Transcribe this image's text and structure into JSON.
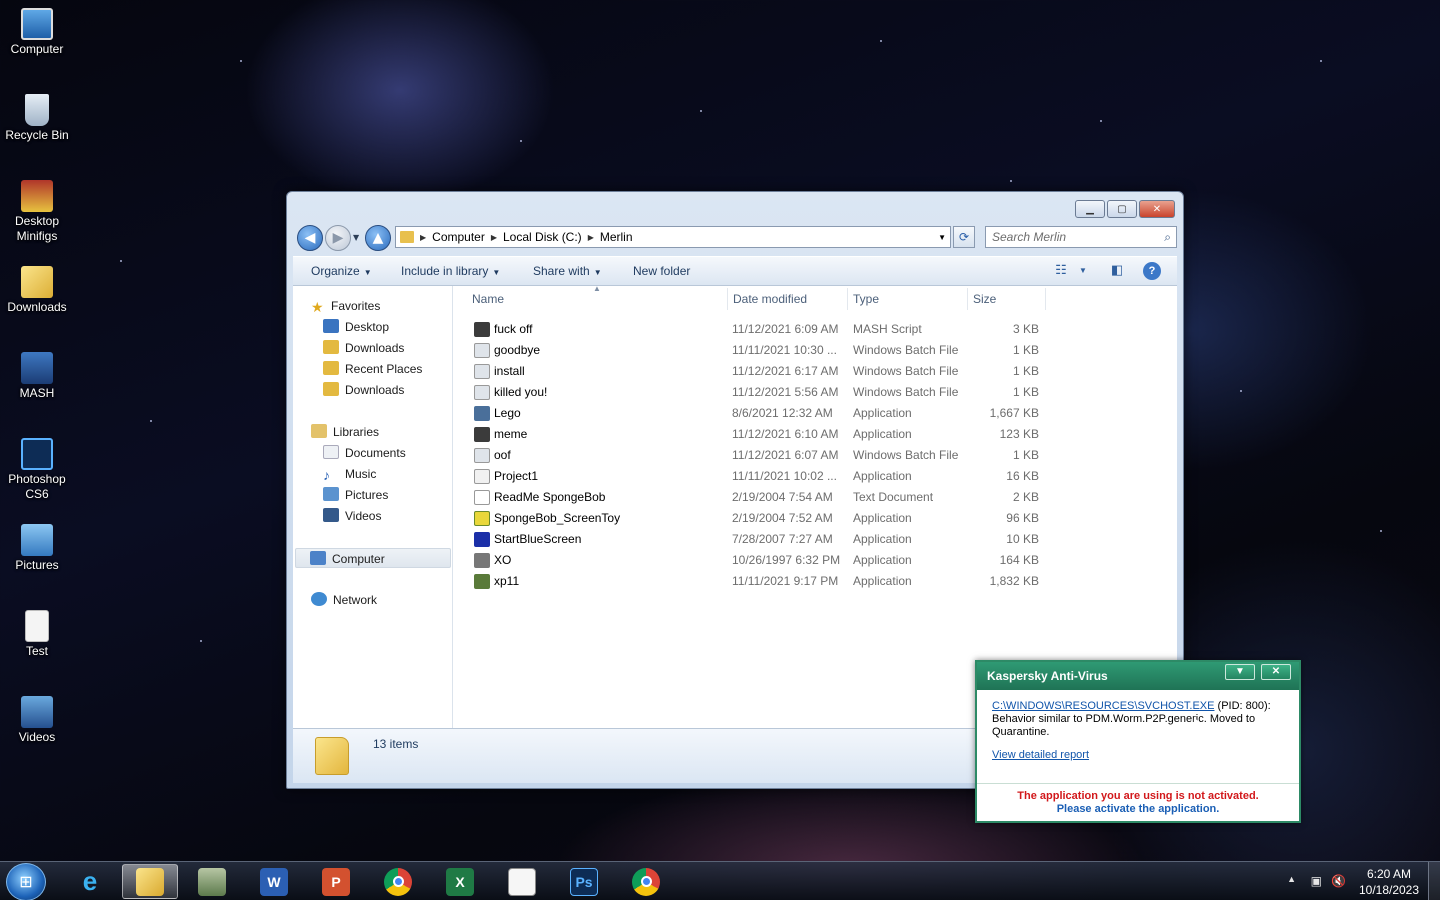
{
  "desktop": {
    "icons": [
      {
        "label": "Computer"
      },
      {
        "label": "Recycle Bin"
      },
      {
        "label": "Desktop Minifigs"
      },
      {
        "label": "Downloads"
      },
      {
        "label": "MASH"
      },
      {
        "label": "Photoshop CS6"
      },
      {
        "label": "Pictures"
      },
      {
        "label": "Test"
      },
      {
        "label": "Videos"
      }
    ]
  },
  "explorer": {
    "address": [
      "Computer",
      "Local Disk (C:)",
      "Merlin"
    ],
    "search_placeholder": "Search Merlin",
    "toolbar": {
      "organize": "Organize",
      "include_in_library": "Include in library",
      "share_with": "Share with",
      "new_folder": "New folder"
    },
    "nav": {
      "favorites": "Favorites",
      "favorites_items": [
        "Desktop",
        "Downloads",
        "Recent Places",
        "Downloads"
      ],
      "libraries": "Libraries",
      "libraries_items": [
        "Documents",
        "Music",
        "Pictures",
        "Videos"
      ],
      "computer": "Computer",
      "network": "Network"
    },
    "columns": {
      "name": "Name",
      "date": "Date modified",
      "type": "Type",
      "size": "Size"
    },
    "files": [
      {
        "name": "fuck off",
        "date": "11/12/2021 6:09 AM",
        "type": "MASH Script",
        "size": "3 KB"
      },
      {
        "name": "goodbye",
        "date": "11/11/2021 10:30 ...",
        "type": "Windows Batch File",
        "size": "1 KB"
      },
      {
        "name": "install",
        "date": "11/12/2021 6:17 AM",
        "type": "Windows Batch File",
        "size": "1 KB"
      },
      {
        "name": "killed you!",
        "date": "11/12/2021 5:56 AM",
        "type": "Windows Batch File",
        "size": "1 KB"
      },
      {
        "name": "Lego",
        "date": "8/6/2021 12:32 AM",
        "type": "Application",
        "size": "1,667 KB"
      },
      {
        "name": "meme",
        "date": "11/12/2021 6:10 AM",
        "type": "Application",
        "size": "123 KB"
      },
      {
        "name": "oof",
        "date": "11/12/2021 6:07 AM",
        "type": "Windows Batch File",
        "size": "1 KB"
      },
      {
        "name": "Project1",
        "date": "11/11/2021 10:02 ...",
        "type": "Application",
        "size": "16 KB"
      },
      {
        "name": "ReadMe SpongeBob",
        "date": "2/19/2004 7:54 AM",
        "type": "Text Document",
        "size": "2 KB"
      },
      {
        "name": "SpongeBob_ScreenToy",
        "date": "2/19/2004 7:52 AM",
        "type": "Application",
        "size": "96 KB"
      },
      {
        "name": "StartBlueScreen",
        "date": "7/28/2007 7:27 AM",
        "type": "Application",
        "size": "10 KB"
      },
      {
        "name": "XO",
        "date": "10/26/1997 6:32 PM",
        "type": "Application",
        "size": "164 KB"
      },
      {
        "name": "xp11",
        "date": "11/11/2021 9:17 PM",
        "type": "Application",
        "size": "1,832 KB"
      }
    ],
    "status": "13 items"
  },
  "kaspersky": {
    "title": "Kaspersky Anti-Virus",
    "path": "C:\\WINDOWS\\RESOURCES\\SVCHOST.EXE",
    "pid": " (PID: 800):",
    "message": "Behavior similar to PDM.Worm.P2P.generic. Moved to Quarantine.",
    "report_link": "View detailed report",
    "warning": "The application you are using is not activated.",
    "activate": "Please activate the application."
  },
  "taskbar": {
    "time": "6:20 AM",
    "date": "10/18/2023"
  },
  "colors": {
    "kaspersky_green": "#1f7355",
    "warning_red": "#d2181b",
    "link_blue": "#1155aa"
  }
}
